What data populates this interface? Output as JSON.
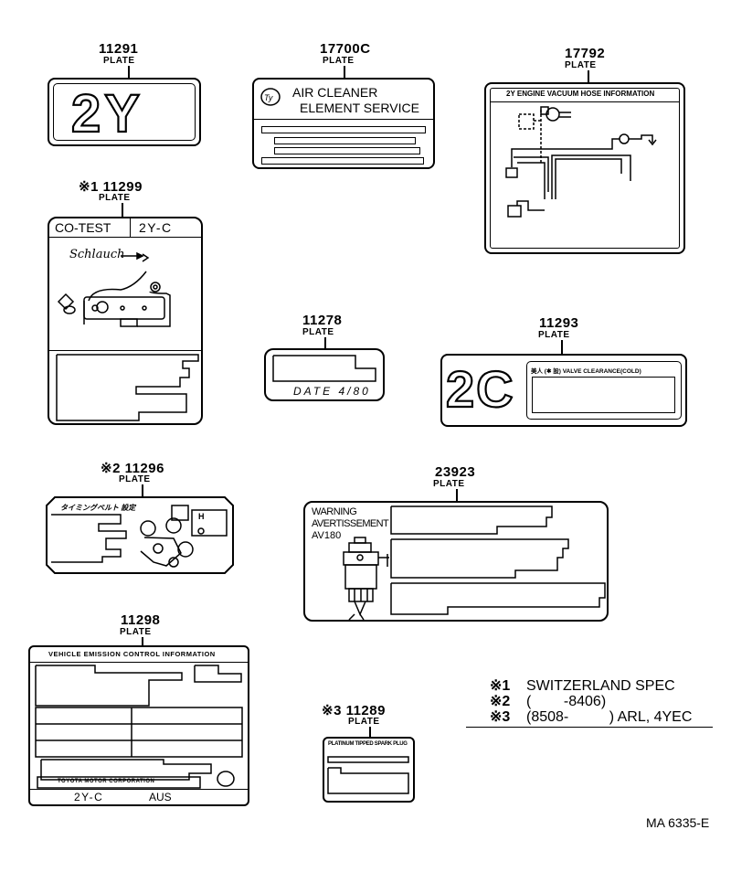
{
  "title": "Caution plate / name plate parts diagram",
  "parts": [
    {
      "id": "p11291",
      "part_no": "11291",
      "name": "PLATE",
      "label": "2Y"
    },
    {
      "id": "p17700c",
      "part_no": "17700C",
      "name": "PLATE",
      "line1": "AIR CLEANER",
      "line2": "ELEMENT SERVICE"
    },
    {
      "id": "p17792",
      "part_no": "17792",
      "name": "PLATE",
      "header": "2Y  ENGINE  VACUUM HOSE  INFORMATION"
    },
    {
      "id": "p111299",
      "part_no": "※1 11299",
      "name": "PLATE",
      "cell_left": "CO-TEST",
      "cell_right": "2Y-C",
      "annotation": "Schlauch"
    },
    {
      "id": "p11278",
      "part_no": "11278",
      "name": "PLATE",
      "footer": "DATE 4/80"
    },
    {
      "id": "p11293",
      "part_no": "11293",
      "name": "PLATE",
      "label": "2C",
      "header": "美人 (✱ 設) VALVE CLEARANCE(COLD)"
    },
    {
      "id": "p211296",
      "part_no": "※2 11296",
      "name": "PLATE",
      "header": "タイミングベルト 設定",
      "marker": "H"
    },
    {
      "id": "p23923",
      "part_no": "23923",
      "name": "PLATE",
      "line1": "WARNING",
      "line2": "AVERTISSEMENT",
      "line3": "AV180"
    },
    {
      "id": "p11298",
      "part_no": "11298",
      "name": "PLATE",
      "header": "VEHICLE  EMISSION  CONTROL  INFORMATION",
      "maker": "TOYOTA MOTOR   CORPORATION",
      "foot_left": "2Y-C",
      "foot_right": "AUS"
    },
    {
      "id": "p11289",
      "part_no": "※3 11289",
      "name": "PLATE",
      "header": "PLATINUM TIPPED SPARK PLUG"
    }
  ],
  "legend": [
    {
      "mark": "※1",
      "text": "SWITZERLAND SPEC"
    },
    {
      "mark": "※2",
      "text": "(        -8406)"
    },
    {
      "mark": "※3",
      "text": "(8508-          ) ARL, 4YEC"
    }
  ],
  "drawing_code": "MA 6335-E"
}
